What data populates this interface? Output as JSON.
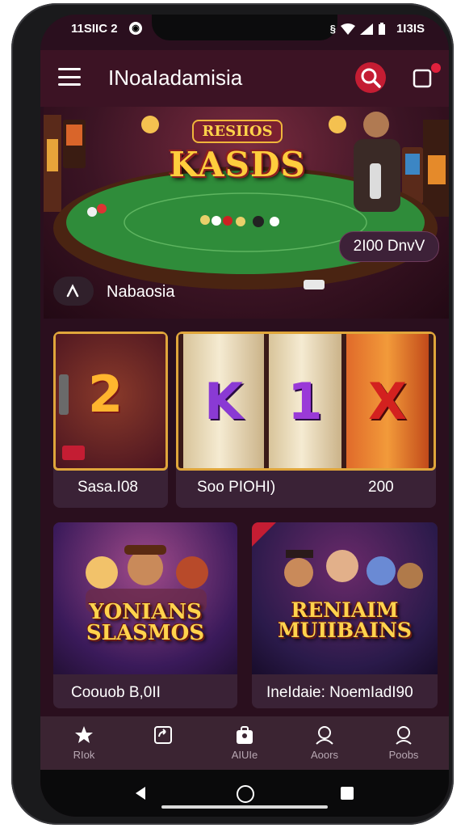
{
  "statusbar": {
    "time": "11SIIC 2",
    "right_text": "1I3IS"
  },
  "appbar": {
    "title": "INoaIadamisia"
  },
  "hero": {
    "logo_small": "RESIIOS",
    "logo_big": "KASDS",
    "price": "2I00 DnvV",
    "caption": "Nabaosia"
  },
  "games": [
    {
      "label": "Sasa.I08",
      "symbol": "2"
    },
    {
      "label": "Soo PIOHI)",
      "value": "200",
      "symbols": [
        "K",
        "1",
        "X"
      ]
    }
  ],
  "promos": [
    {
      "label": "Coouob   B,0II",
      "title_lines": [
        "YONIANS",
        "SLASMOS"
      ]
    },
    {
      "label": "IneIdaie: NoemIadI90",
      "title_lines": [
        "RENIAIM",
        "MUIIBAINS"
      ]
    }
  ],
  "nav": [
    {
      "label": "RIok",
      "icon": "star-icon"
    },
    {
      "label": "",
      "icon": "refresh-icon"
    },
    {
      "label": "AIUIe",
      "icon": "briefcase-icon"
    },
    {
      "label": "Aoors",
      "icon": "user-icon"
    },
    {
      "label": "Poobs",
      "icon": "profile-icon"
    }
  ],
  "colors": {
    "background": "#2a0f1e",
    "appbar": "#3c1324",
    "accent_red": "#c41d33",
    "gold": "#e0a63b",
    "card": "#3a2236",
    "navbar": "#3b2432"
  }
}
